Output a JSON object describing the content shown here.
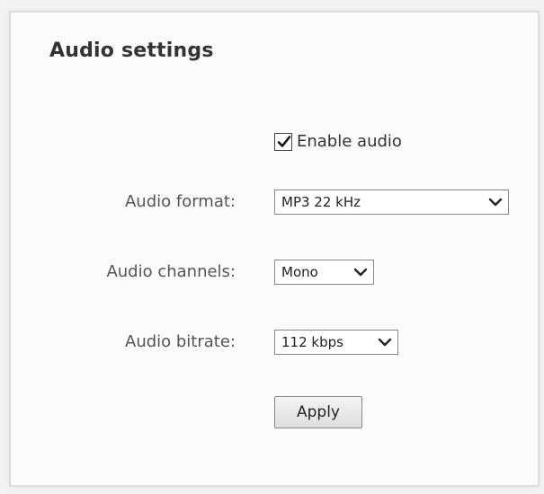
{
  "panel": {
    "title": "Audio settings"
  },
  "enable_audio": {
    "label": "Enable audio",
    "checked": true
  },
  "audio_format": {
    "label": "Audio format:",
    "selected": "MP3 22 kHz"
  },
  "audio_channels": {
    "label": "Audio channels:",
    "selected": "Mono"
  },
  "audio_bitrate": {
    "label": "Audio bitrate:",
    "selected": "112 kbps"
  },
  "apply_button": {
    "label": "Apply"
  },
  "icons": {
    "checkbox_check": "check-icon",
    "dropdown": "chevron-down-icon"
  }
}
